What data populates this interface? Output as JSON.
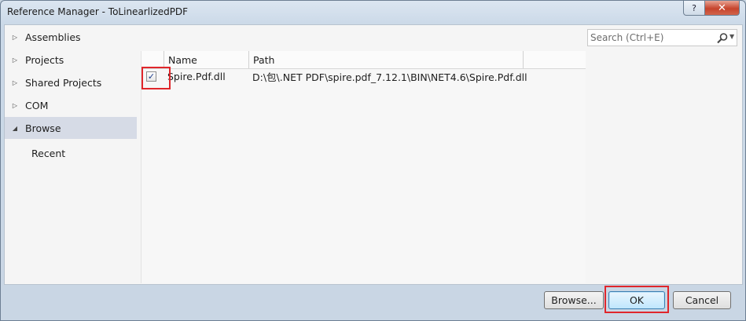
{
  "window": {
    "title": "Reference Manager - ToLinearlizedPDF",
    "help_label": "?",
    "close_label": "✕"
  },
  "nav": {
    "items": [
      {
        "label": "Assemblies",
        "arrow": "▷"
      },
      {
        "label": "Projects",
        "arrow": "▷"
      },
      {
        "label": "Shared Projects",
        "arrow": "▷"
      },
      {
        "label": "COM",
        "arrow": "▷"
      },
      {
        "label": "Browse",
        "arrow": "◢"
      }
    ],
    "sub_items": [
      {
        "label": "Recent"
      }
    ]
  },
  "list": {
    "columns": [
      "Name",
      "Path"
    ],
    "rows": [
      {
        "checked": true,
        "name": "Spire.Pdf.dll",
        "path": "D:\\包\\.NET PDF\\spire.pdf_7.12.1\\BIN\\NET4.6\\Spire.Pdf.dll"
      }
    ],
    "check_glyph": "✓"
  },
  "search": {
    "placeholder": "Search (Ctrl+E)",
    "value": "",
    "dropdown_glyph": "▼"
  },
  "buttons": {
    "browse": "Browse...",
    "ok": "OK",
    "cancel": "Cancel"
  },
  "colors": {
    "highlight": "#e0262b",
    "selected_nav": "#d6dbe6"
  }
}
